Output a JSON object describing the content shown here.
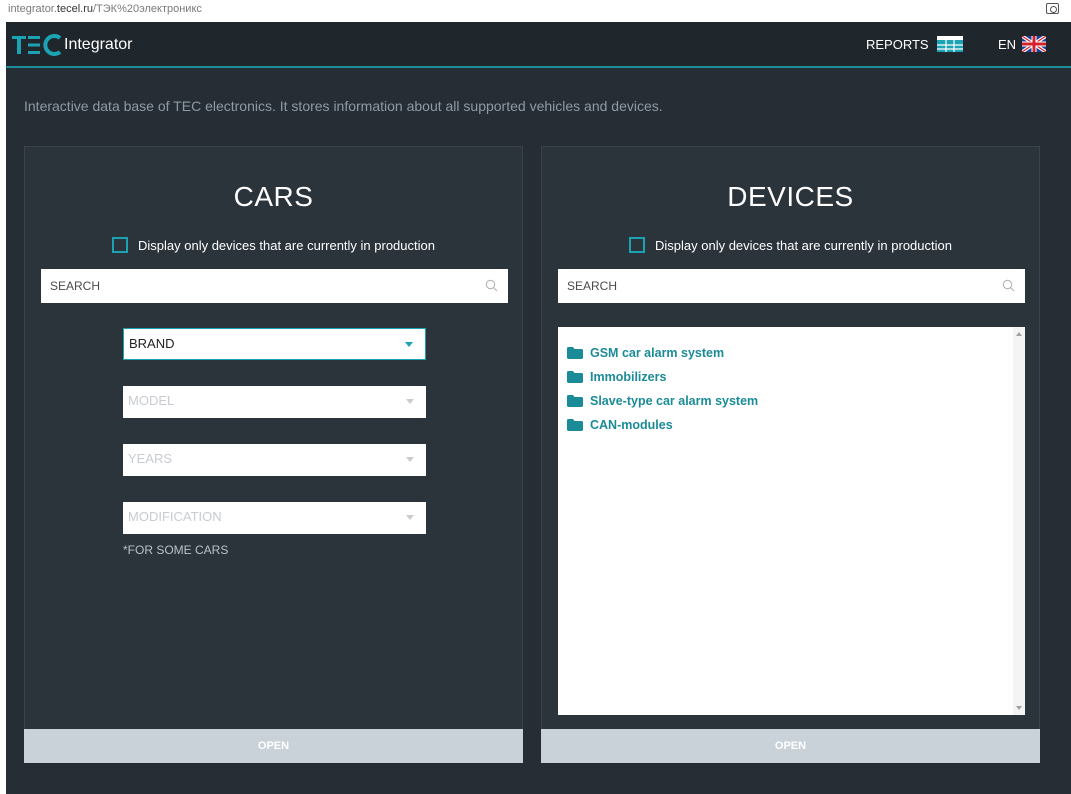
{
  "browser": {
    "url_prefix": "integrator.",
    "url_domain": "tecel.ru",
    "url_path": "/ТЭК%20электроникс"
  },
  "header": {
    "logo_text": "TEC",
    "app_title": "Integrator",
    "reports_label": "REPORTS",
    "language_label": "EN",
    "accent_color": "#1d8f9c"
  },
  "intro_text": "Interactive data base of TEC electronics. It stores information about all supported vehicles and devices.",
  "cars": {
    "title": "CARS",
    "production_checkbox_label": "Display only devices that are currently in production",
    "search_placeholder": "SEARCH",
    "brand_select": "BRAND",
    "model_select": "MODEL",
    "years_select": "YEARS",
    "modification_select": "MODIFICATION",
    "note": "*FOR SOME CARS",
    "open_label": "OPEN"
  },
  "devices": {
    "title": "DEVICES",
    "production_checkbox_label": "Display only devices that are currently in production",
    "search_placeholder": "SEARCH",
    "categories": [
      {
        "label": "GSM car alarm system"
      },
      {
        "label": "Immobilizers"
      },
      {
        "label": "Slave-type car alarm system"
      },
      {
        "label": "CAN-modules"
      }
    ],
    "open_label": "OPEN"
  }
}
